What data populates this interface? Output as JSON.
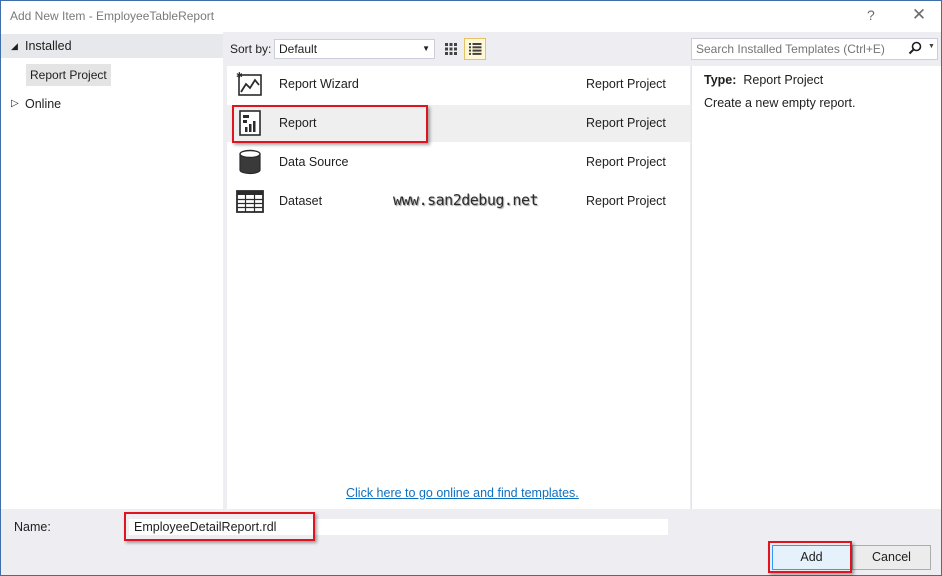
{
  "window": {
    "title": "Add New Item - EmployeeTableReport",
    "help_label": "?",
    "close_label": "✕"
  },
  "tree": {
    "installed_label": "Installed",
    "report_project_label": "Report Project",
    "online_label": "Online"
  },
  "toolbar": {
    "sort_label": "Sort by:",
    "sort_value": "Default",
    "search_placeholder": "Search Installed Templates (Ctrl+E)"
  },
  "templates": [
    {
      "name": "Report Wizard",
      "type": "Report Project",
      "icon": "report-wizard-icon"
    },
    {
      "name": "Report",
      "type": "Report Project",
      "icon": "report-icon"
    },
    {
      "name": "Data Source",
      "type": "Report Project",
      "icon": "data-source-icon"
    },
    {
      "name": "Dataset",
      "type": "Report Project",
      "icon": "dataset-icon"
    }
  ],
  "watermark": "www.san2debug.net",
  "online_link": "Click here to go online and find templates.",
  "info": {
    "type_label": "Type:",
    "type_value": "Report Project",
    "description": "Create a new empty report."
  },
  "form": {
    "name_label": "Name:",
    "name_value": "EmployeeDetailReport.rdl"
  },
  "buttons": {
    "add_label": "Add",
    "cancel_label": "Cancel"
  },
  "colors": {
    "annotation": "#e0141e",
    "link": "#0e70c0",
    "selection": "#efefef"
  }
}
